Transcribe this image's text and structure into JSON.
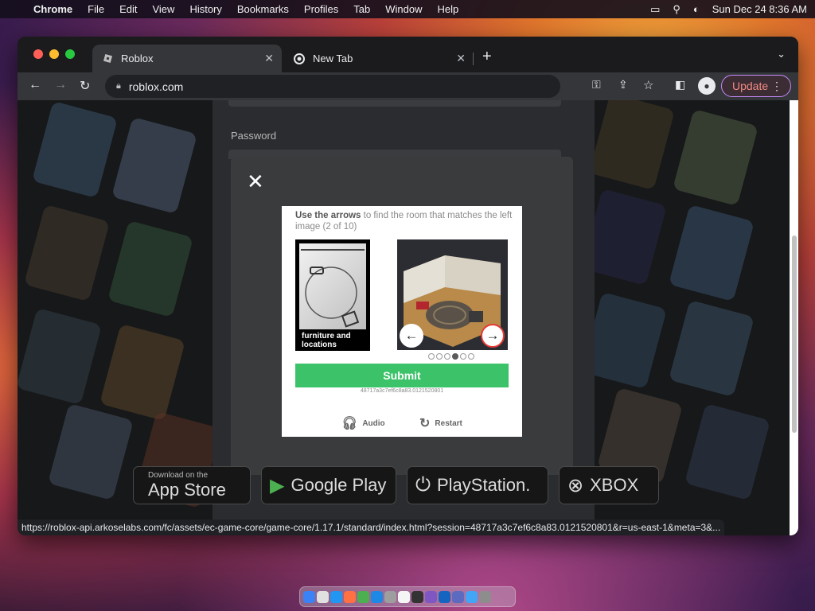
{
  "menubar": {
    "apple": "",
    "app_name": "Chrome",
    "items": [
      "File",
      "Edit",
      "View",
      "History",
      "Bookmarks",
      "Profiles",
      "Tab",
      "Window",
      "Help"
    ],
    "datetime": "Sun Dec 24  8:36 AM"
  },
  "tabs": [
    {
      "title": "Roblox",
      "active": true
    },
    {
      "title": "New Tab",
      "active": false
    }
  ],
  "toolbar": {
    "url": "roblox.com",
    "update_label": "Update"
  },
  "page": {
    "password_label": "Password"
  },
  "captcha": {
    "instruction_bold": "Use the arrows",
    "instruction_rest": " to find the room that matches the left image (2 of 10)",
    "left_caption": "furniture and locations",
    "current_option": 4,
    "total_options": 6,
    "submit_label": "Submit",
    "session_id": "48717a3c7ef6c8a83.0121520801",
    "audio_label": "Audio",
    "restart_label": "Restart"
  },
  "store_badges": {
    "appstore_small": "Download on the",
    "appstore_big": "App Store",
    "googleplay": "Google Play",
    "playstation": "PlayStation.",
    "xbox": "XBOX"
  },
  "status_url": "https://roblox-api.arkoselabs.com/fc/assets/ec-game-core/game-core/1.17.1/standard/index.html?session=48717a3c7ef6c8a83.0121520801&r=us-east-1&meta=3&...",
  "colors": {
    "submit": "#3cc269",
    "update_border": "#c58af9"
  }
}
